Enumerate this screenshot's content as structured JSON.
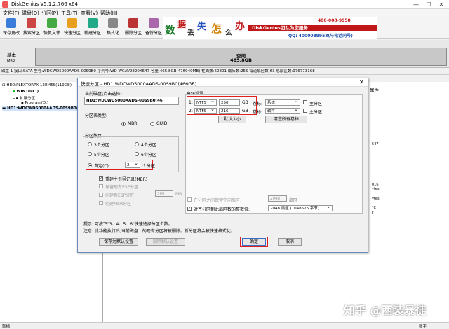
{
  "window": {
    "title": "DiskGenius V5.1.2.766 x64",
    "min": "—",
    "max": "☐",
    "close": "✕"
  },
  "menu": [
    "文件(F)",
    "磁盘(D)",
    "分区(P)",
    "工具(T)",
    "查看(V)",
    "帮助(H)"
  ],
  "toolbar": [
    {
      "label": "保存更改",
      "color": "#3b7dd8"
    },
    {
      "label": "搜索分区",
      "color": "#c44"
    },
    {
      "label": "恢复文件",
      "color": "#4a4"
    },
    {
      "label": "快速分区",
      "color": "#e8a020"
    },
    {
      "label": "新建分区",
      "color": "#2a8"
    },
    {
      "label": "格式化",
      "color": "#888"
    },
    {
      "label": "删除分区",
      "color": "#b33"
    },
    {
      "label": "备份分区",
      "color": "#a6a"
    }
  ],
  "banner": {
    "chars": [
      "数",
      "据",
      "丢",
      "失",
      "怎",
      "么",
      "办"
    ],
    "brand": "DiskGenius团队为您服务",
    "phone1": "400-008-9958",
    "qq": "QQ: 4000089958(与电话同号)"
  },
  "diskmap": {
    "label": "基本",
    "label2": "MBR",
    "bar_title": "空闲",
    "bar_size": "465.8GB"
  },
  "infobar": "磁盘 1 接口:SATA  型号:WDCWD5000AADS-00S9B0  序列号:WD-WCAV9820X547  容量:465.8GB(476940MB)  柱面数:60801  磁头数:255  每道扇区数:63  总扇区数:976773168",
  "tree": [
    {
      "text": "HD0:PLEXTORPX-128M5S(119GB)"
    },
    {
      "text": "WIN10(C:)"
    },
    {
      "text": "扩展分区"
    },
    {
      "text": "Program(D:)"
    },
    {
      "text": "HD1:WDCWD5000AADS-00S9B0(466GB)"
    }
  ],
  "right": {
    "header": "属性",
    "v1": "547",
    "v2": "MB",
    "v3": "016",
    "v4": "ytes",
    "v5": "ytes",
    "v6": "°C",
    "v7": "F"
  },
  "dialog": {
    "title": "快速分区 - HD1:WDCWD5000AADS-00S9B0(466GB)",
    "close": "✕",
    "current_disk_label": "当前磁盘(点击选择)",
    "current_disk_value": "HD1:WDCWD5000AADS-00S9B0(46",
    "table_type_label": "分区表类型:",
    "mbr": "MBR",
    "guid": "GUID",
    "count_label": "分区数目",
    "opt3": "3个分区",
    "opt4": "4个分区",
    "opt5": "5个分区",
    "opt6": "6个分区",
    "custom": "自定(C):",
    "custom_value": "2",
    "custom_unit": "个分区",
    "rebuild_mbr": "重建主引导记录(MBR)",
    "keep_esp": "保留现有ESP分区",
    "create_esp": "创建新ESP分区:",
    "esp_size": "300",
    "esp_unit": "MB",
    "create_msr": "创建MSR分区",
    "adv_label": "高级设置",
    "rows": [
      {
        "idx": "1:",
        "fs": "NTFS",
        "size": "250",
        "unit": "GB",
        "vol_label": "卷标:",
        "vol": "系统",
        "primary": "主分区"
      },
      {
        "idx": "2:",
        "fs": "NTFS",
        "size": "216",
        "unit": "GB",
        "vol_label": "卷标:",
        "vol": "软件",
        "primary": "主分区"
      }
    ],
    "default_size_btn": "默认大小",
    "clear_labels_btn": "清空所有卷标",
    "reserve_label": "在分区之间保留空闲扇区:",
    "reserve_value": "2048",
    "reserve_unit": "扇区",
    "align_label": "对齐分区到此扇区数的整数倍:",
    "align_value": "2048 扇区 (1048576 字节)",
    "hint": "提示: 可按下\"3、4、5、6\"快速选择分区个数。",
    "note": "注意: 此功能执行后,当前磁盘上的现有分区将被删除。新分区将会被快速格式化。",
    "save_default_btn": "保存为默认设置",
    "delete_default_btn": "删除默认设置",
    "ok_btn": "确定",
    "cancel_btn": "取消"
  },
  "watermark": "知乎 @西装暴徒",
  "status": {
    "left": "就绪",
    "right": "数字"
  }
}
